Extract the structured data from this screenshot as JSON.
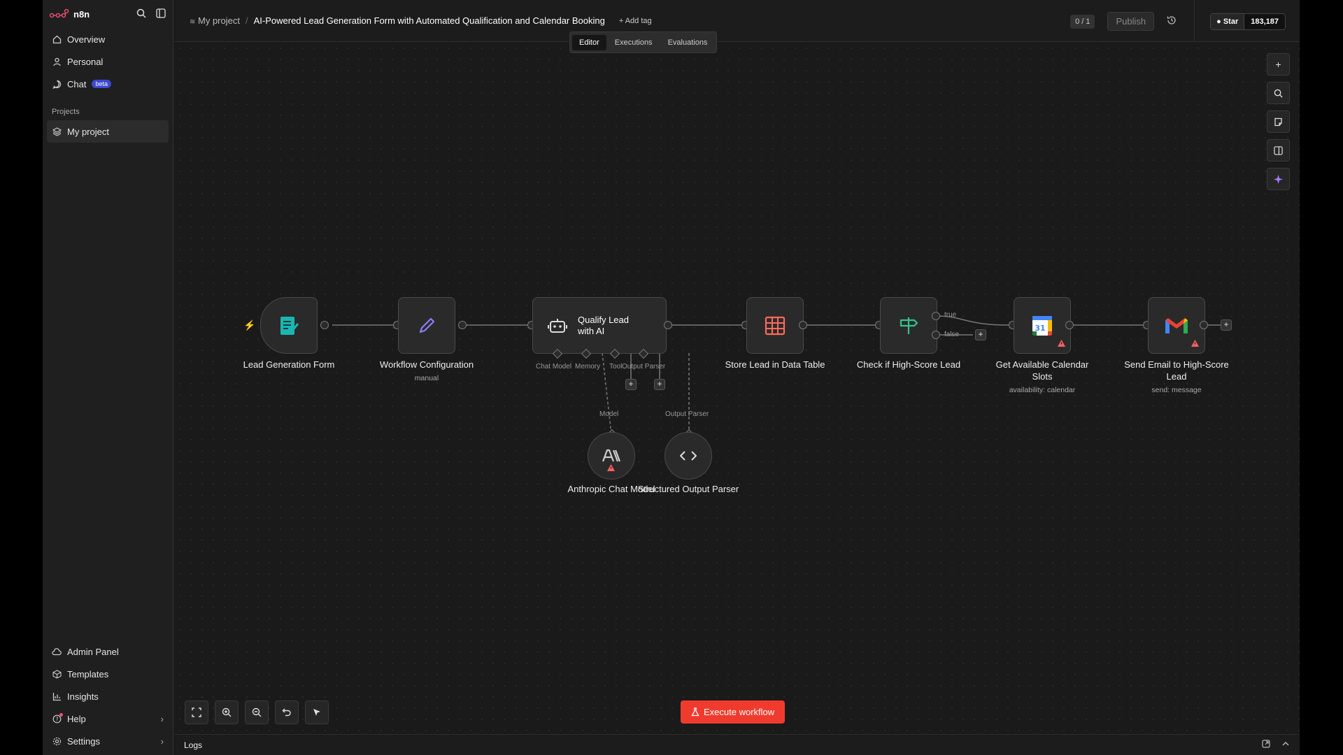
{
  "app": {
    "logo_text": "n8n"
  },
  "sidebar": {
    "items": [
      {
        "label": "Overview"
      },
      {
        "label": "Personal"
      },
      {
        "label": "Chat",
        "badge": "beta"
      }
    ],
    "projects_label": "Projects",
    "project_item": "My project",
    "bottom": [
      {
        "label": "Admin Panel"
      },
      {
        "label": "Templates"
      },
      {
        "label": "Insights"
      },
      {
        "label": "Help"
      },
      {
        "label": "Settings"
      }
    ]
  },
  "header": {
    "project": "My project",
    "separator": "/",
    "workflow_title": "AI-Powered Lead Generation Form with Automated Qualification and Calendar Booking",
    "add_tag": "+ Add tag",
    "tabs": [
      "Editor",
      "Executions",
      "Evaluations"
    ],
    "counter": "0 / 1",
    "publish": "Publish",
    "github": {
      "star": "Star",
      "count": "183,187"
    }
  },
  "nodes": {
    "lead_form": {
      "label": "Lead Generation Form"
    },
    "workflow_config": {
      "label": "Workflow Configuration",
      "sub": "manual"
    },
    "qualify": {
      "label": "Qualify Lead with AI",
      "ports": [
        "Chat Model",
        "Memory",
        "Tool",
        "Output Parser"
      ]
    },
    "store": {
      "label": "Store Lead in Data Table"
    },
    "check": {
      "label": "Check if High-Score Lead",
      "out_true": "true",
      "out_false": "false"
    },
    "calendar": {
      "label": "Get Available Calendar Slots",
      "sub": "availability: calendar"
    },
    "email": {
      "label": "Send Email to High-Score Lead",
      "sub": "send: message"
    },
    "anthropic": {
      "label": "Anthropic Chat Model",
      "conn": "Model"
    },
    "parser": {
      "label": "Structured Output Parser",
      "conn": "Output Parser"
    }
  },
  "canvas": {
    "execute_button": "Execute workflow"
  },
  "logs": {
    "label": "Logs"
  },
  "colors": {
    "accent": "#ef3b2d",
    "beta": "#3b4ad1"
  }
}
